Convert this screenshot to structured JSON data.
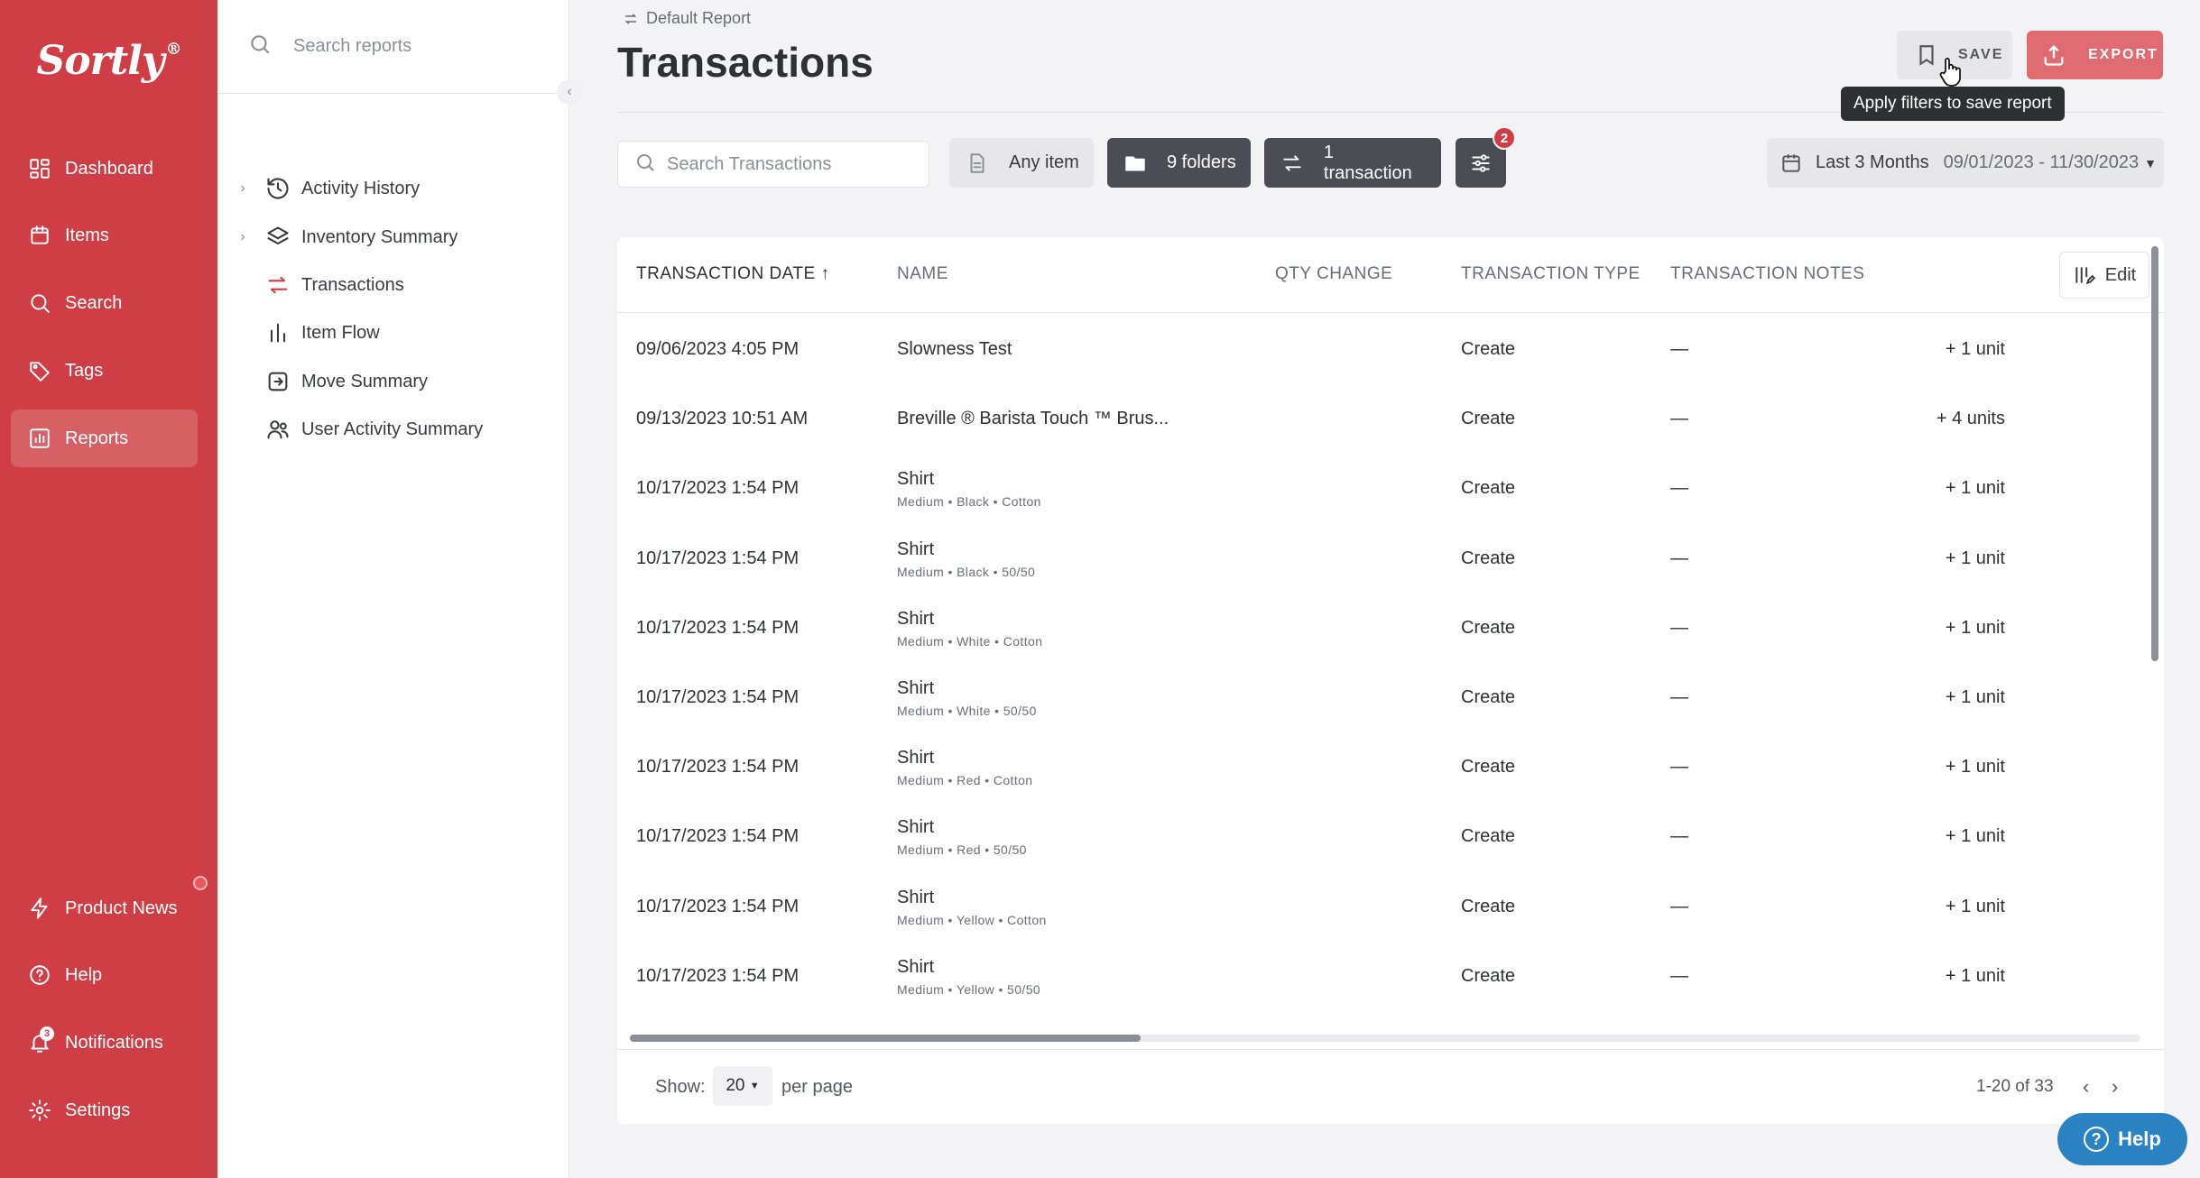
{
  "brand": {
    "name": "Sortly",
    "mark": "®"
  },
  "nav": {
    "items": [
      {
        "label": "Dashboard",
        "icon": "dashboard-icon"
      },
      {
        "label": "Items",
        "icon": "items-icon"
      },
      {
        "label": "Search",
        "icon": "search-icon"
      },
      {
        "label": "Tags",
        "icon": "tag-icon"
      },
      {
        "label": "Reports",
        "icon": "reports-icon",
        "active": true
      }
    ],
    "bottom": [
      {
        "label": "Product News",
        "icon": "lightning-icon"
      },
      {
        "label": "Help",
        "icon": "help-icon"
      },
      {
        "label": "Notifications",
        "icon": "bell-icon",
        "count": "3"
      },
      {
        "label": "Settings",
        "icon": "gear-icon"
      }
    ]
  },
  "reports_sidebar": {
    "search_placeholder": "Search reports",
    "items": [
      {
        "label": "Activity History",
        "expandable": true
      },
      {
        "label": "Inventory Summary",
        "expandable": true
      },
      {
        "label": "Transactions",
        "active": true
      },
      {
        "label": "Item Flow"
      },
      {
        "label": "Move Summary"
      },
      {
        "label": "User Activity Summary"
      }
    ]
  },
  "header": {
    "breadcrumb": "Default Report",
    "title": "Transactions",
    "save_label": "SAVE",
    "export_label": "EXPORT",
    "tooltip": "Apply filters to save report"
  },
  "filters": {
    "search_placeholder": "Search Transactions",
    "any_item": "Any item",
    "folders": "9 folders",
    "transaction": "1 transaction",
    "filter_count": "2",
    "date_label": "Last 3 Months",
    "date_range": "09/01/2023 - 11/30/2023"
  },
  "table": {
    "columns": [
      "TRANSACTION DATE",
      "NAME",
      "QTY CHANGE",
      "TRANSACTION TYPE",
      "TRANSACTION NOTES"
    ],
    "edit_label": "Edit",
    "rows": [
      {
        "date": "09/06/2023 4:05 PM",
        "name": "Slowness Test",
        "sub": "",
        "qty": "+ 1  unit",
        "type": "Create",
        "notes": "—"
      },
      {
        "date": "09/13/2023 10:51 AM",
        "name": "Breville ® Barista Touch ™ Brus...",
        "sub": "",
        "qty": "+ 4  units",
        "type": "Create",
        "notes": "—"
      },
      {
        "date": "10/17/2023 1:54 PM",
        "name": "Shirt",
        "sub": "Medium • Black • Cotton",
        "qty": "+ 1  unit",
        "type": "Create",
        "notes": "—"
      },
      {
        "date": "10/17/2023 1:54 PM",
        "name": "Shirt",
        "sub": "Medium • Black • 50/50",
        "qty": "+ 1  unit",
        "type": "Create",
        "notes": "—"
      },
      {
        "date": "10/17/2023 1:54 PM",
        "name": "Shirt",
        "sub": "Medium • White • Cotton",
        "qty": "+ 1  unit",
        "type": "Create",
        "notes": "—"
      },
      {
        "date": "10/17/2023 1:54 PM",
        "name": "Shirt",
        "sub": "Medium • White • 50/50",
        "qty": "+ 1  unit",
        "type": "Create",
        "notes": "—"
      },
      {
        "date": "10/17/2023 1:54 PM",
        "name": "Shirt",
        "sub": "Medium • Red • Cotton",
        "qty": "+ 1  unit",
        "type": "Create",
        "notes": "—"
      },
      {
        "date": "10/17/2023 1:54 PM",
        "name": "Shirt",
        "sub": "Medium • Red • 50/50",
        "qty": "+ 1  unit",
        "type": "Create",
        "notes": "—"
      },
      {
        "date": "10/17/2023 1:54 PM",
        "name": "Shirt",
        "sub": "Medium • Yellow • Cotton",
        "qty": "+ 1  unit",
        "type": "Create",
        "notes": "—"
      },
      {
        "date": "10/17/2023 1:54 PM",
        "name": "Shirt",
        "sub": "Medium • Yellow • 50/50",
        "qty": "+ 1  unit",
        "type": "Create",
        "notes": "—"
      }
    ]
  },
  "pagination": {
    "show_label": "Show:",
    "per_page": "20",
    "per_page_label": "per page",
    "info": "1-20 of 33"
  },
  "help_fab": {
    "label": "Help"
  },
  "colors": {
    "brand": "#cf3e44",
    "dark_chip": "#4b4d55",
    "help": "#2c83c3"
  }
}
